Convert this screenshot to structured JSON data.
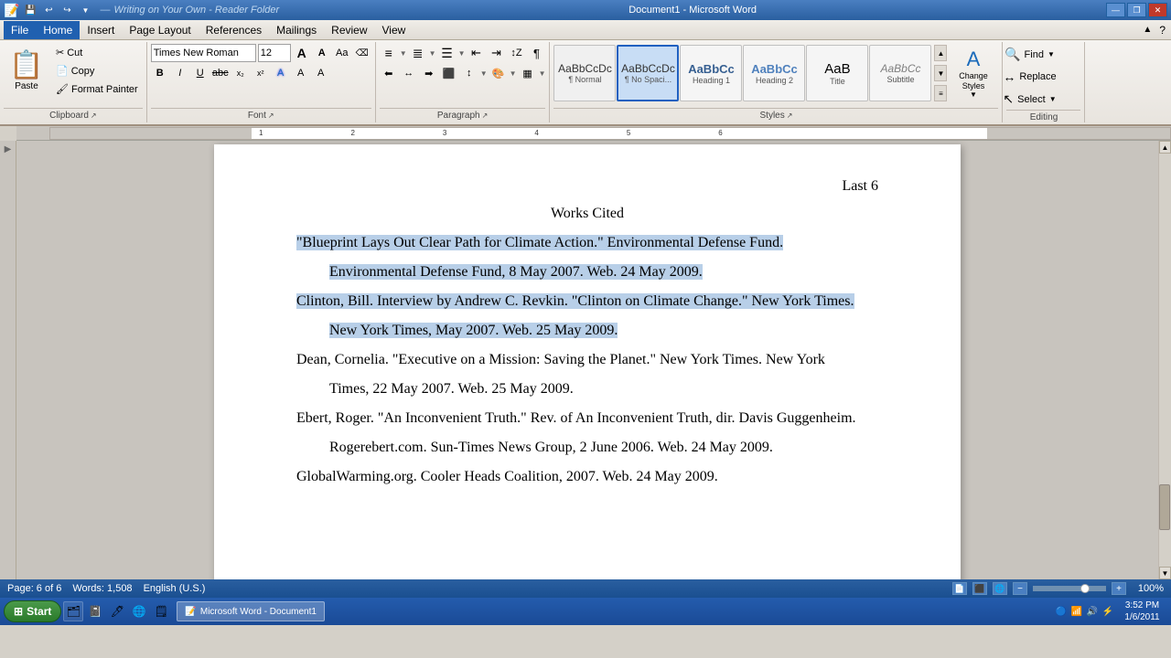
{
  "titlebar": {
    "title": "Document1 - Microsoft Word",
    "app_icons": [
      "💾",
      "↩",
      "↪"
    ],
    "win_buttons": [
      "—",
      "□",
      "✕"
    ]
  },
  "menubar": {
    "items": [
      "File",
      "Home",
      "Insert",
      "Page Layout",
      "References",
      "Mailings",
      "Review",
      "View"
    ],
    "active": "Home"
  },
  "ribbon": {
    "clipboard": {
      "paste_label": "Paste",
      "cut_label": "Cut",
      "copy_label": "Copy",
      "format_painter_label": "Format Painter",
      "group_label": "Clipboard"
    },
    "font": {
      "font_name": "Times New Roman",
      "font_size": "12",
      "group_label": "Font",
      "bold": "B",
      "italic": "I",
      "underline": "U",
      "strikethrough": "abc",
      "subscript": "x₂",
      "superscript": "x²"
    },
    "paragraph": {
      "group_label": "Paragraph"
    },
    "styles": {
      "group_label": "Styles",
      "items": [
        {
          "name": "Normal",
          "preview": "AaBbCcDc"
        },
        {
          "name": "No Spaci...",
          "preview": "AaBbCcDc"
        },
        {
          "name": "Heading 1",
          "preview": "AaBbCc"
        },
        {
          "name": "Heading 2",
          "preview": "AaBbCc"
        },
        {
          "name": "Title",
          "preview": "AaB"
        },
        {
          "name": "Subtitle",
          "preview": "AaBbCc"
        }
      ],
      "selected_index": 1,
      "change_styles_label": "Change\nStyles"
    },
    "editing": {
      "find_label": "Find",
      "replace_label": "Replace",
      "select_label": "Select",
      "group_label": "Editing"
    }
  },
  "document": {
    "page_header": "Last 6",
    "title": "Works Cited",
    "citations": [
      {
        "text": "\"Blueprint Lays Out Clear Path for Climate Action.\" Environmental Defense Fund.\nEnvironmental Defense Fund, 8 May 2007. Web. 24 May 2009.",
        "selected": true
      },
      {
        "text": "Clinton, Bill. Interview by Andrew C. Revkin. \"Clinton on Climate Change.\" New York Times.\nNew York Times, May 2007. Web. 25 May 2009.",
        "selected": true
      },
      {
        "text": "Dean, Cornelia. \"Executive on a Mission: Saving the Planet.\" New York Times. New York\nTimes, 22 May 2007. Web. 25 May 2009.",
        "selected": false
      },
      {
        "text": "Ebert, Roger. \"An Inconvenient Truth.\" Rev. of An Inconvenient Truth, dir. Davis Guggenheim.\nRogerebert.com. Sun-Times News Group, 2 June 2006. Web. 24 May 2009.",
        "selected": false
      },
      {
        "text": "GlobalWarming.org. Cooler Heads Coalition, 2007. Web. 24 May 2009.",
        "selected": false
      }
    ]
  },
  "statusbar": {
    "page": "Page: 6 of 6",
    "words": "Words: 1,508",
    "language": "English (U.S.)",
    "zoom": "100%",
    "time": "3:52 PM\n1/6/2011"
  },
  "taskbar": {
    "start_label": "Start",
    "open_windows": [
      "Microsoft Word - Document1"
    ],
    "time": "3:52 PM",
    "date": "1/6/2011"
  }
}
